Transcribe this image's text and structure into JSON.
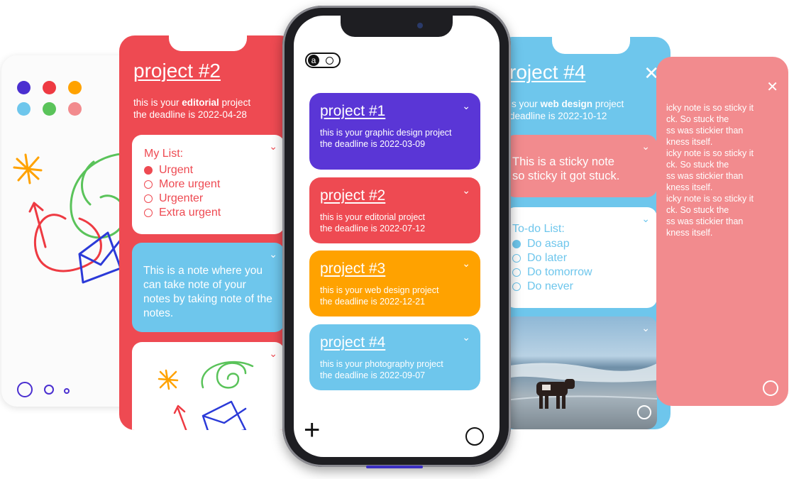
{
  "colors": {
    "purple": "#5a36d6",
    "red": "#ee4a52",
    "orange": "#ffa200",
    "blue": "#6ec6ec",
    "pink": "#f28b8e",
    "green": "#5ac35a"
  },
  "white_screen": {
    "palette": [
      "#4a2fd0",
      "#ee3a42",
      "#ffa200",
      "#6ec6ec",
      "#5ac35a",
      "#f28b8e"
    ]
  },
  "red_screen": {
    "title": "project #2",
    "desc_prefix": "this is your ",
    "desc_bold": "editorial",
    "desc_suffix": " project",
    "deadline": "the deadline is 2022-04-28",
    "list_title": "My List:",
    "list_items": [
      "Urgent",
      "More urgent",
      "Urgenter",
      "Extra urgent"
    ],
    "note": "This is a note where you can take note of your notes by taking note of the notes."
  },
  "phone": {
    "logo_letter": "a",
    "projects": [
      {
        "title": "project #1",
        "desc_prefix": "this is your ",
        "desc_bold": "graphic design",
        "desc_suffix": " project",
        "deadline": "the deadline is 2022-03-09"
      },
      {
        "title": "project #2",
        "desc_prefix": "this is your ",
        "desc_bold": "editorial",
        "desc_suffix": " project",
        "deadline": "the deadline is 2022-07-12"
      },
      {
        "title": "project #3",
        "desc_prefix": "this is your ",
        "desc_bold": "web design",
        "desc_suffix": " project",
        "deadline": "the deadline is 2022-12-21"
      },
      {
        "title": "project #4",
        "desc_prefix": "this is your ",
        "desc_bold": "photography",
        "desc_suffix": " project",
        "deadline": "the deadline is 2022-09-07"
      }
    ],
    "add_glyph": "+"
  },
  "blue_screen": {
    "title": "roject #4",
    "desc_prefix": "is your ",
    "desc_bold": "web design",
    "desc_suffix": " project",
    "deadline": "deadline is 2022-10-12",
    "sticky_line1": "This is a sticky note",
    "sticky_line2": "so sticky it got stuck.",
    "todo_title": "To-do List:",
    "todo_items": [
      "Do asap",
      "Do later",
      "Do tomorrow",
      "Do never"
    ]
  },
  "pink_screen": {
    "lines": [
      "icky note is so sticky it",
      "ck. So stuck the",
      "ss was stickier than",
      "kness itself.",
      "icky note is so sticky it",
      "ck. So stuck the",
      "ss was stickier than",
      "kness itself.",
      "icky note is so sticky it",
      "ck. So stuck the",
      "ss was stickier than",
      "kness itself."
    ]
  }
}
